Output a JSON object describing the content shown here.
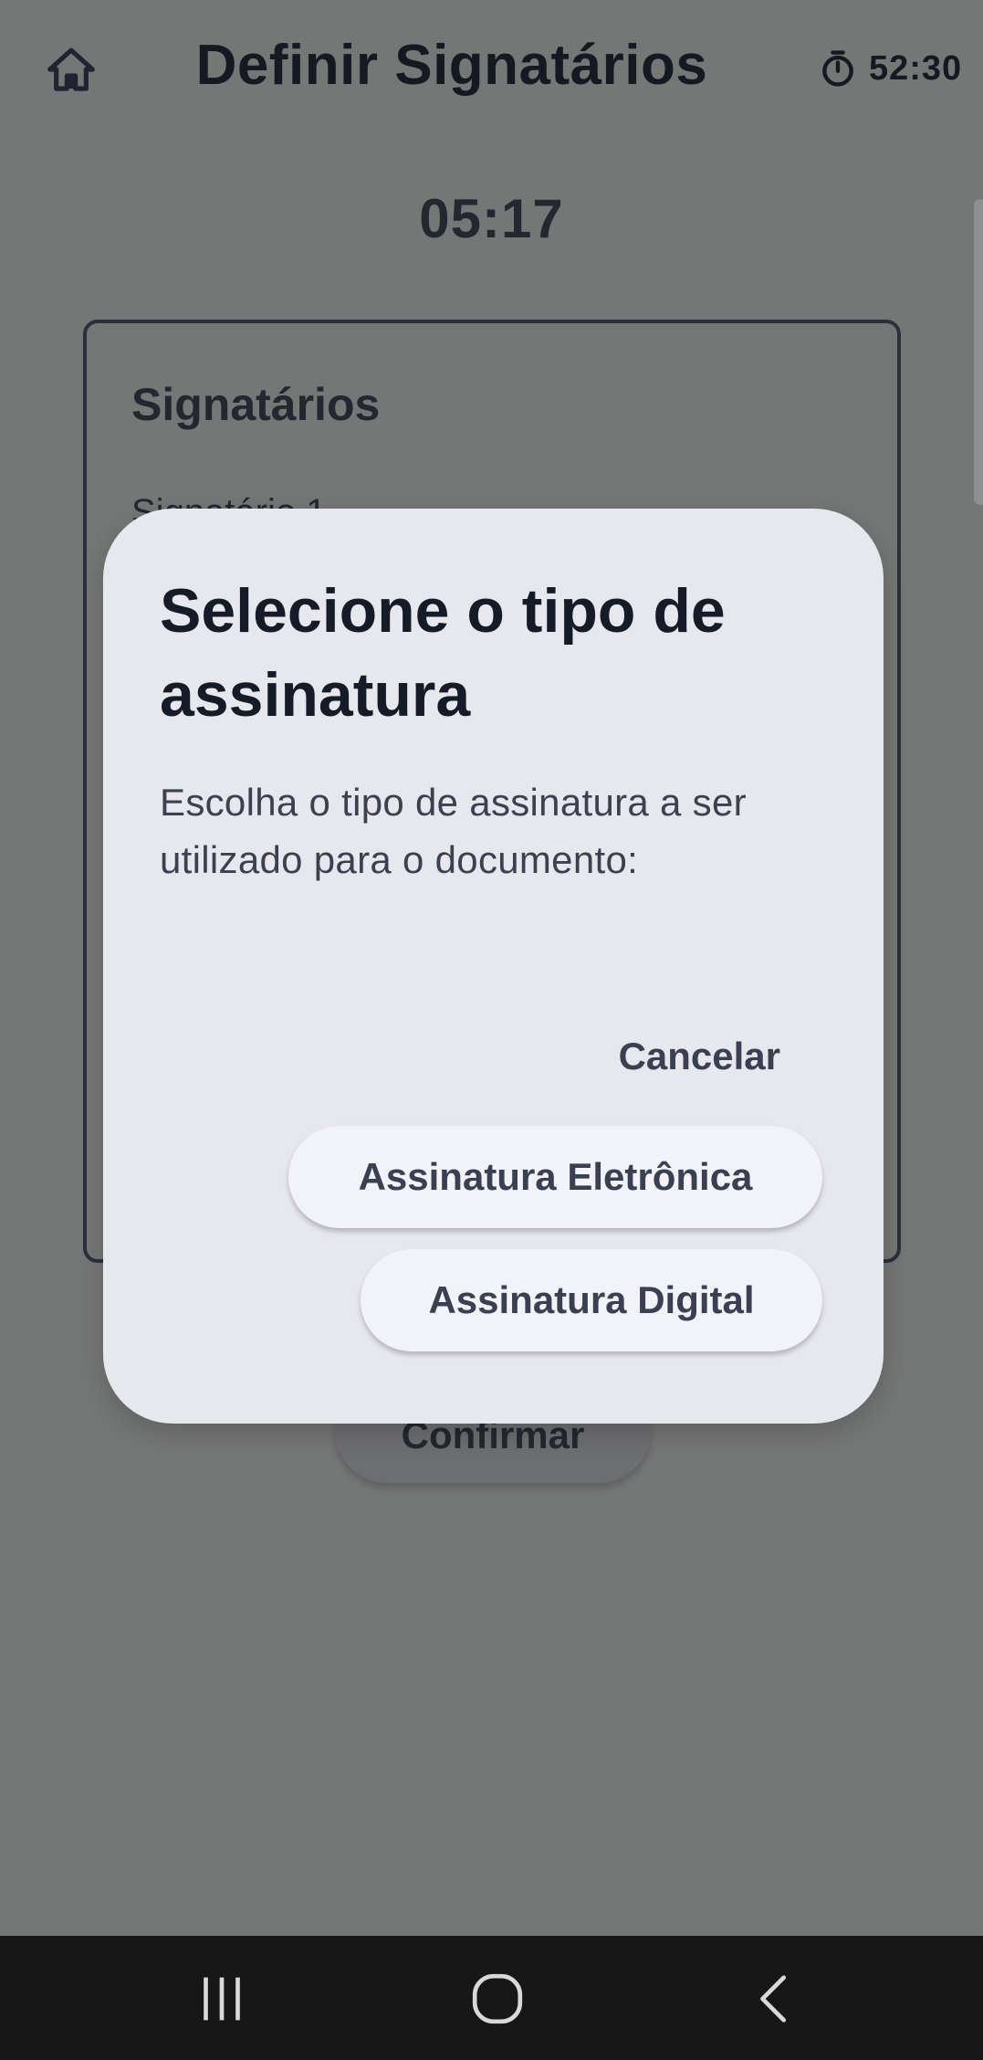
{
  "header": {
    "title": "Definir Signatários",
    "home_icon": "home-icon",
    "timer_icon": "stopwatch-icon",
    "timer": "52:30"
  },
  "countdown": "05:17",
  "card": {
    "title": "Signatários",
    "item_label": "Signatário 1"
  },
  "confirm_label": "Confirmar",
  "dialog": {
    "title": "Selecione o tipo de assinatura",
    "message": "Escolha o tipo de assinatura a ser utilizado para o documento:",
    "cancel_label": "Cancelar",
    "electronic_label": "Assinatura Eletrônica",
    "digital_label": "Assinatura Digital"
  },
  "navbar": {
    "recent_icon": "recent-apps-icon",
    "home_icon": "home-circle-icon",
    "back_icon": "back-chevron-icon"
  },
  "colors": {
    "scrim": "#757676",
    "dialog_bg": "#e7e8ee",
    "button_bg": "#f2f3f8",
    "text_dark": "#161b28",
    "navbar_bg": "#171717"
  }
}
